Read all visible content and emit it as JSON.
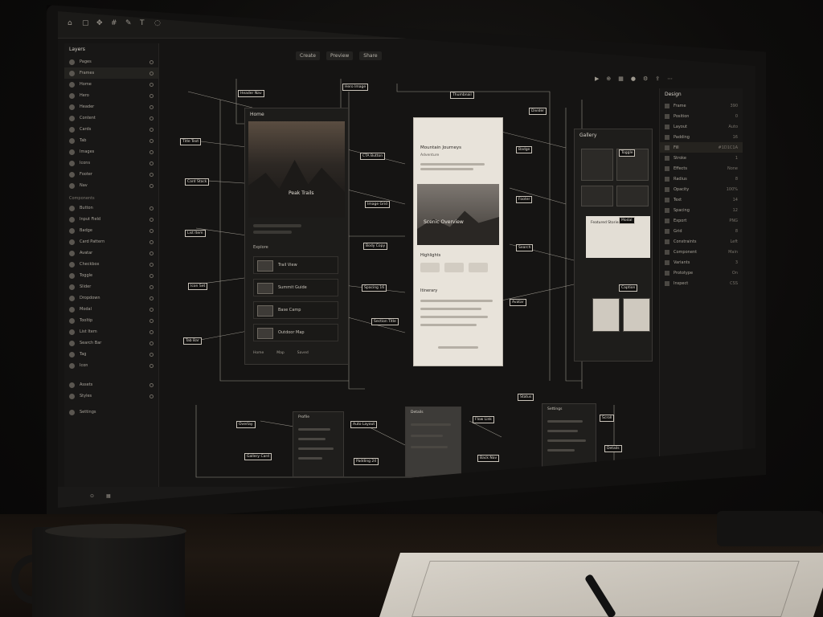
{
  "toolbar": {
    "tabs": [
      "Create",
      "Preview",
      "Share"
    ]
  },
  "sidebar": {
    "header": "Layers",
    "items": [
      {
        "label": "Pages"
      },
      {
        "label": "Frames"
      },
      {
        "label": "Home"
      },
      {
        "label": "Hero"
      },
      {
        "label": "Header"
      },
      {
        "label": "Content"
      },
      {
        "label": "Cards"
      },
      {
        "label": "Tab"
      },
      {
        "label": "Images"
      },
      {
        "label": "Icons"
      },
      {
        "label": "Footer"
      },
      {
        "label": "Nav"
      }
    ],
    "section_label": "Components",
    "items2": [
      {
        "label": "Button"
      },
      {
        "label": "Input Field"
      },
      {
        "label": "Badge"
      },
      {
        "label": "Card Pattern"
      },
      {
        "label": "Avatar"
      },
      {
        "label": "Checkbox"
      },
      {
        "label": "Toggle"
      },
      {
        "label": "Slider"
      },
      {
        "label": "Dropdown"
      },
      {
        "label": "Modal"
      },
      {
        "label": "Tooltip"
      },
      {
        "label": "List Item"
      },
      {
        "label": "Search Bar"
      },
      {
        "label": "Tag"
      },
      {
        "label": "Icon"
      }
    ],
    "footer_items": [
      {
        "label": "Assets"
      },
      {
        "label": "Styles"
      }
    ],
    "bottom_label": "Settings"
  },
  "canvas": {
    "frame_left": {
      "title": "Home",
      "hero_caption": "Peak Trails",
      "section_label": "Explore",
      "rows": [
        "Trail View",
        "Summit Guide",
        "Base Camp",
        "Outdoor Map"
      ],
      "nav_items": [
        "Home",
        "Map",
        "Saved"
      ]
    },
    "frame_mid": {
      "title": "Mountain Journeys",
      "subtitle": "Adventure",
      "image_caption": "Scenic Overview",
      "section_label": "Highlights",
      "section2_label": "Itinerary"
    },
    "frame_right": {
      "title": "Gallery",
      "card_title": "Featured Stories"
    },
    "bottom_frames": [
      "Profile",
      "Details",
      "Settings"
    ]
  },
  "props": {
    "header": "Design",
    "rows": [
      {
        "label": "Frame",
        "value": "390"
      },
      {
        "label": "Position",
        "value": "0"
      },
      {
        "label": "Layout",
        "value": "Auto"
      },
      {
        "label": "Padding",
        "value": "16"
      },
      {
        "label": "Fill",
        "value": "#1D1C1A"
      },
      {
        "label": "Stroke",
        "value": "1"
      },
      {
        "label": "Effects",
        "value": "None"
      },
      {
        "label": "Radius",
        "value": "8"
      },
      {
        "label": "Opacity",
        "value": "100%"
      },
      {
        "label": "Text",
        "value": "14"
      },
      {
        "label": "Spacing",
        "value": "12"
      },
      {
        "label": "Export",
        "value": "PNG"
      },
      {
        "label": "Grid",
        "value": "8"
      },
      {
        "label": "Constraints",
        "value": "Left"
      },
      {
        "label": "Component",
        "value": "Main"
      },
      {
        "label": "Variants",
        "value": "3"
      },
      {
        "label": "Prototype",
        "value": "On"
      },
      {
        "label": "Inspect",
        "value": "CSS"
      }
    ]
  },
  "annotations": [
    "Header Nav",
    "Hero Image",
    "Title Text",
    "Card Stack",
    "List Item",
    "Icon Set",
    "Tab Bar",
    "CTA Button",
    "Image Grid",
    "Body Copy",
    "Spacing 16",
    "Section Title",
    "Thumbnail",
    "Badge",
    "Footer",
    "Search",
    "Avatar",
    "Divider",
    "Toggle",
    "Modal",
    "Caption",
    "Overlay",
    "Gallery Card",
    "Auto Layout",
    "Padding 24",
    "Flow Link",
    "Back Nav",
    "Scroll",
    "Details",
    "Status"
  ]
}
